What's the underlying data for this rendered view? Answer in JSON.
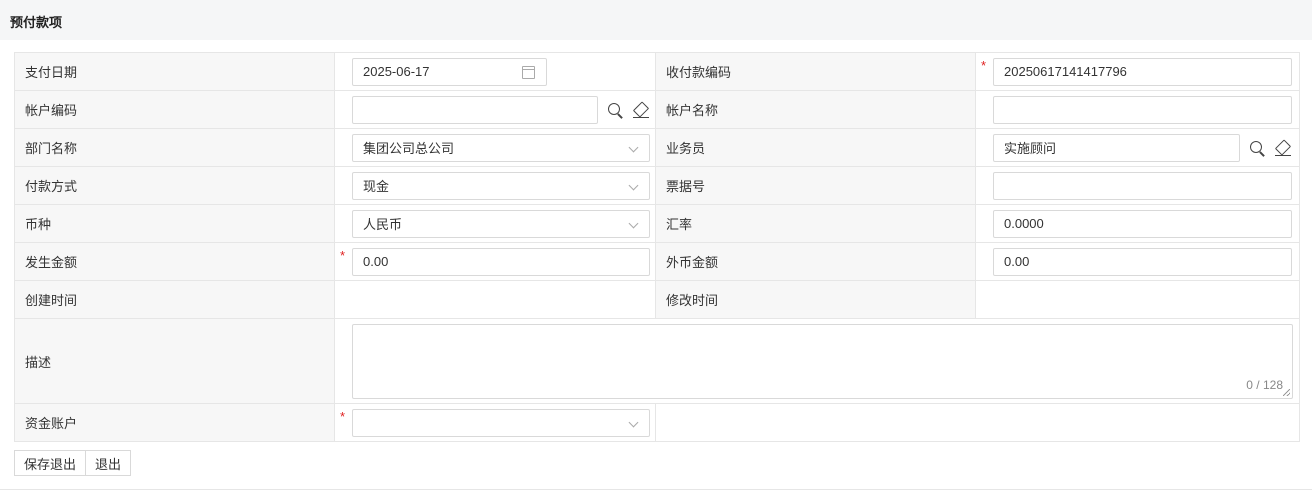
{
  "page": {
    "title": "预付款项"
  },
  "form": {
    "pay_date": {
      "label": "支付日期",
      "value": "2025-06-17"
    },
    "receipt_code": {
      "label": "收付款编码",
      "value": "20250617141417796"
    },
    "account_code": {
      "label": "帐户编码",
      "value": ""
    },
    "account_name": {
      "label": "帐户名称",
      "value": ""
    },
    "department": {
      "label": "部门名称",
      "value": "集团公司总公司"
    },
    "salesperson": {
      "label": "业务员",
      "value": "实施顾问"
    },
    "payment_method": {
      "label": "付款方式",
      "value": "现金"
    },
    "ticket_no": {
      "label": "票据号",
      "value": ""
    },
    "currency": {
      "label": "币种",
      "value": "人民币"
    },
    "exchange_rate": {
      "label": "汇率",
      "value": "0.0000"
    },
    "amount": {
      "label": "发生金额",
      "value": "0.00"
    },
    "foreign_amount": {
      "label": "外币金额",
      "value": "0.00"
    },
    "created_time": {
      "label": "创建时间",
      "value": ""
    },
    "modified_time": {
      "label": "修改时间",
      "value": ""
    },
    "description": {
      "label": "描述",
      "value": "",
      "counter": "0 / 128"
    },
    "fund_account": {
      "label": "资金账户",
      "value": ""
    },
    "required_mark": "*"
  },
  "buttons": {
    "save_exit": "保存退出",
    "exit": "退出"
  },
  "icons": {
    "calendar": "calendar-icon",
    "search": "search-icon",
    "clear": "eraser-icon",
    "dropdown": "chevron-down-icon"
  }
}
